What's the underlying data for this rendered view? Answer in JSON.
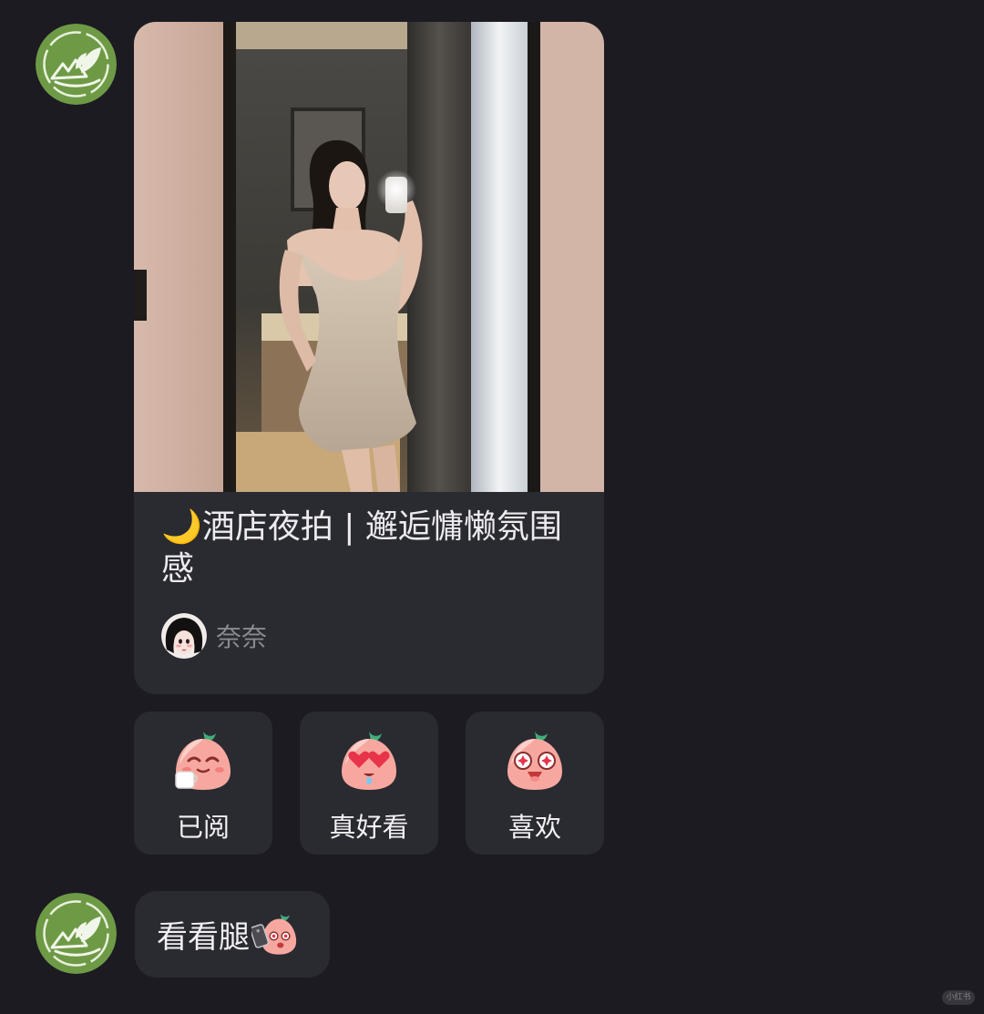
{
  "messages": [
    {
      "type": "note_share",
      "note": {
        "title": "🌙酒店夜拍 | 邂逅慵懒氛围感",
        "author": "奈奈"
      },
      "reactions": [
        {
          "label": "已阅",
          "icon": "peach-tea-emoji"
        },
        {
          "label": "真好看",
          "icon": "peach-heart-eyes-emoji"
        },
        {
          "label": "喜欢",
          "icon": "peach-star-eyes-emoji"
        }
      ]
    },
    {
      "type": "text",
      "text": "看看腿",
      "sticker": "peach-phone-emoji"
    }
  ],
  "watermark": "小红书",
  "colors": {
    "background": "#1c1b22",
    "card": "#2a2a31",
    "title_text": "#ececef",
    "author_text": "#8a8a92",
    "avatar_green": "#6e9a46"
  }
}
